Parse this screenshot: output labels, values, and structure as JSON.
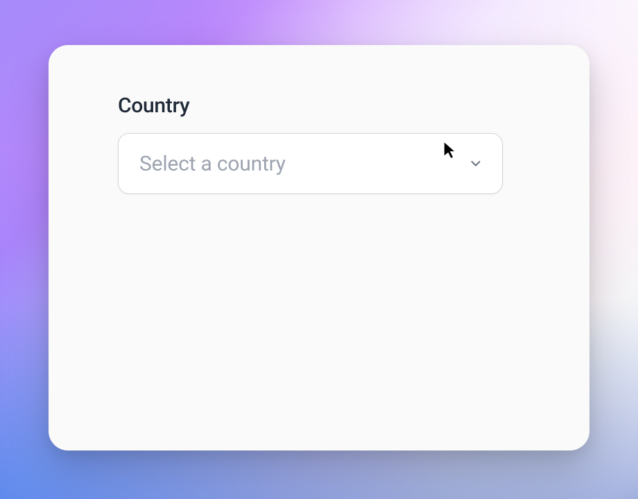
{
  "form": {
    "country_field": {
      "label": "Country",
      "placeholder": "Select a country"
    }
  }
}
